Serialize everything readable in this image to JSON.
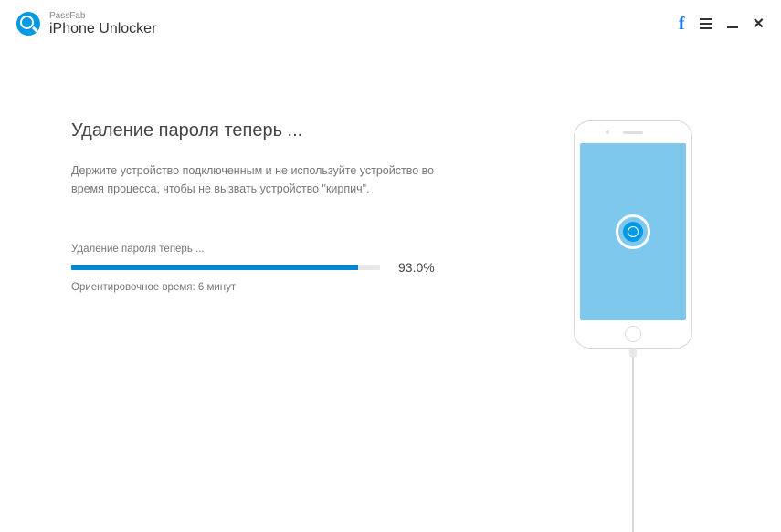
{
  "header": {
    "brand_small": "PassFab",
    "brand_large": "iPhone Unlocker"
  },
  "main": {
    "title": "Удаление пароля теперь ...",
    "description": "Держите устройство подключенным и не используйте устройство во время процесса, чтобы не вызвать устройство \"кирпич\".",
    "progress_label": "Удаление пароля теперь ...",
    "progress_percent_value": 93.0,
    "progress_percent_text": "93.0%",
    "time_estimate": "Ориентировочное время: 6 минут"
  },
  "colors": {
    "accent": "#0099e5",
    "progress": "#0088d4",
    "screen": "#7ec8ed"
  }
}
